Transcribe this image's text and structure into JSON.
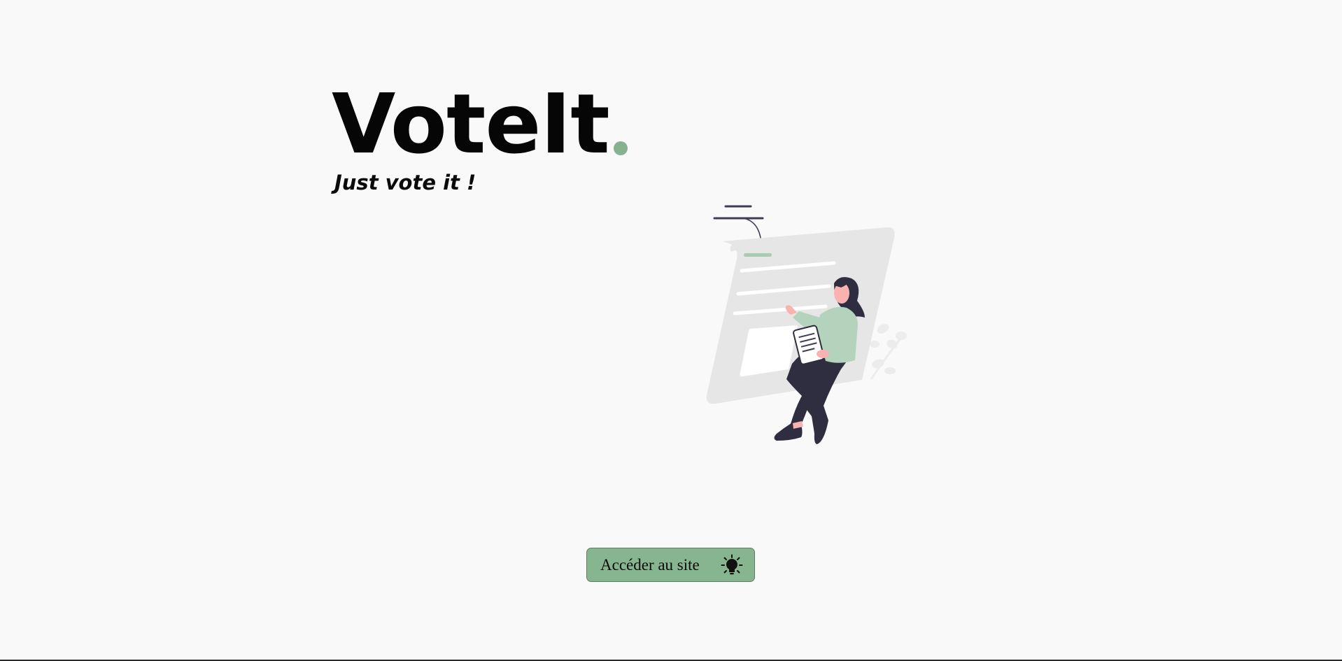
{
  "brand": {
    "name": "VoteIt",
    "tagline": "Just vote it !"
  },
  "hero": {
    "illustration_icon": "woman-voting-illustration"
  },
  "cta": {
    "label": "Accéder au site",
    "icon": "lightbulb-icon"
  },
  "colors": {
    "background": "#f9f9f9",
    "accent": "#8ab594",
    "button_bg": "#87b58f",
    "text": "#060606"
  }
}
